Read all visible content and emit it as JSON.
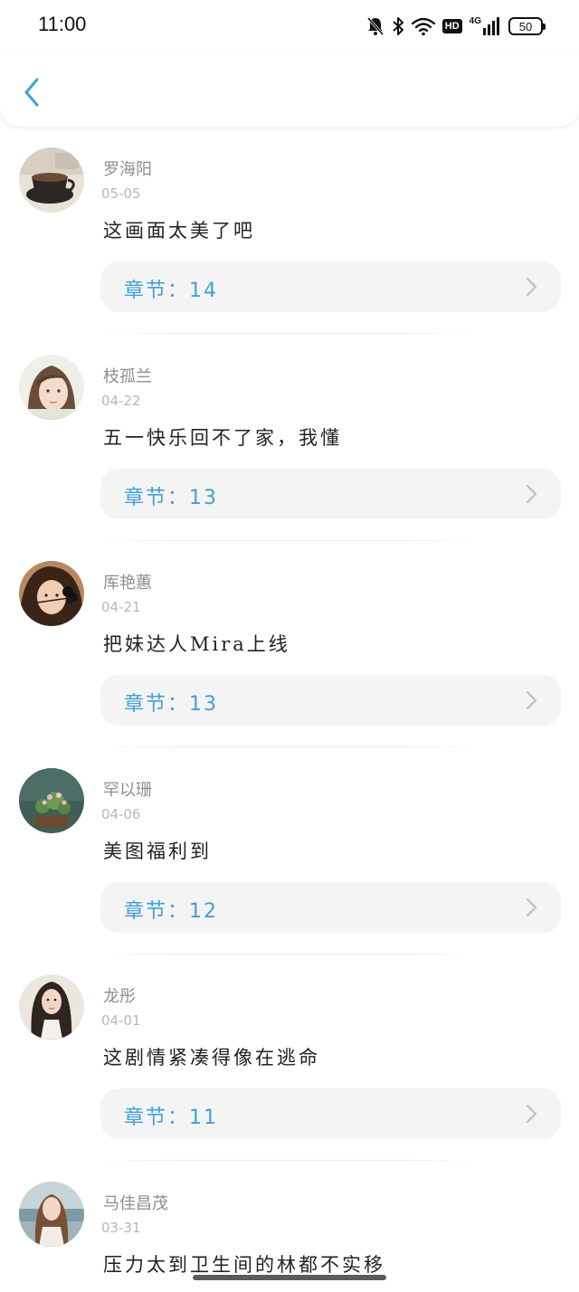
{
  "status_bar": {
    "time": "11:00",
    "hd_label": "HD",
    "network_label": "4G",
    "battery_level": "50"
  },
  "header": {
    "back_icon": "chevron-left-icon",
    "accent_color": "#3fa0d8"
  },
  "comments": [
    {
      "user_name": "罗海阳",
      "date": "05-05",
      "text": "这画面太美了吧",
      "chapter": "章节：14",
      "avatar_icon": "coffee-cup-avatar"
    },
    {
      "user_name": "枝孤兰",
      "date": "04-22",
      "text": "五一快乐回不了家，我懂",
      "chapter": "章节：13",
      "avatar_icon": "girl-portrait-avatar"
    },
    {
      "user_name": "厍艳蕙",
      "date": "04-21",
      "text": "把妹达人Mira上线",
      "chapter": "章节：13",
      "avatar_icon": "child-flower-avatar"
    },
    {
      "user_name": "罕以珊",
      "date": "04-06",
      "text": "美图福利到",
      "chapter": "章节：12",
      "avatar_icon": "flower-pot-avatar"
    },
    {
      "user_name": "龙彤",
      "date": "04-01",
      "text": "这剧情紧凑得像在逃命",
      "chapter": "章节：11",
      "avatar_icon": "woman-long-hair-avatar"
    },
    {
      "user_name": "马佳昌茂",
      "date": "03-31",
      "text": "压力太到卫生间的林都不实移",
      "chapter": "",
      "avatar_icon": "woman-seaside-avatar"
    }
  ]
}
